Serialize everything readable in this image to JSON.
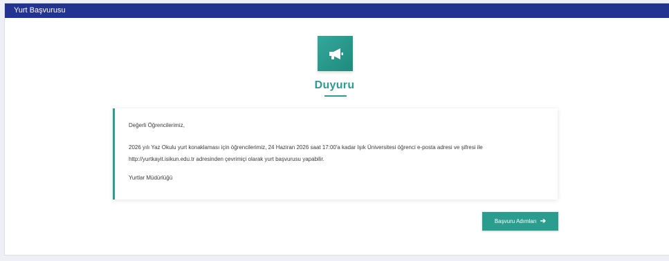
{
  "window": {
    "title": "Yurt Başvurusu"
  },
  "header": {
    "icon": "megaphone-icon",
    "title": "Duyuru"
  },
  "announcement": {
    "greeting": "Değerli Öğrencilerimiz,",
    "body_line1": "2026 yılı Yaz Okulu yurt konaklaması için öğrencilerimiz, 24 Haziran 2026 saat 17:00'a kadar Işık Üniversitesi öğrenci e-posta adresi ve şifresi ile",
    "body_line2": "http://yurtkayit.isikun.edu.tr adresinden çevrimiçi olarak yurt başvurusu yapabilir.",
    "signature": "Yurtlar Müdürlüğü"
  },
  "actions": {
    "apply_label": "Başvuru Adımları",
    "apply_icon": "arrow-right-icon"
  },
  "colors": {
    "titlebar": "#233392",
    "accent": "#2a9d8f",
    "background": "#eef0f5"
  }
}
